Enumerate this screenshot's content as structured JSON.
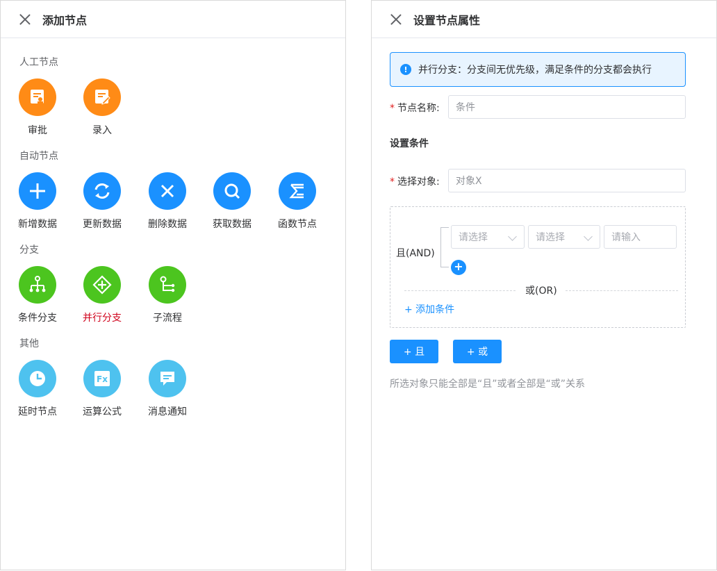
{
  "left": {
    "title": "添加节点",
    "groups": [
      {
        "title": "人工节点",
        "nodes": [
          {
            "label": "审批",
            "icon": "approval-icon",
            "color": "#ff8b16"
          },
          {
            "label": "录入",
            "icon": "entry-icon",
            "color": "#ff8b16"
          }
        ]
      },
      {
        "title": "自动节点",
        "nodes": [
          {
            "label": "新增数据",
            "icon": "plus-icon",
            "color": "#1a91ff"
          },
          {
            "label": "更新数据",
            "icon": "refresh-icon",
            "color": "#1a91ff"
          },
          {
            "label": "删除数据",
            "icon": "close-icon",
            "color": "#1a91ff"
          },
          {
            "label": "获取数据",
            "icon": "search-icon",
            "color": "#1a91ff"
          },
          {
            "label": "函数节点",
            "icon": "sigma-icon",
            "color": "#1a91ff"
          }
        ]
      },
      {
        "title": "分支",
        "nodes": [
          {
            "label": "条件分支",
            "icon": "condition-branch-icon",
            "color": "#4cc51f"
          },
          {
            "label": "并行分支",
            "icon": "parallel-branch-icon",
            "color": "#4cc51f",
            "selected": true
          },
          {
            "label": "子流程",
            "icon": "subflow-icon",
            "color": "#4cc51f"
          }
        ]
      },
      {
        "title": "其他",
        "nodes": [
          {
            "label": "延时节点",
            "icon": "clock-icon",
            "color": "#4ec2ef"
          },
          {
            "label": "运算公式",
            "icon": "formula-icon",
            "color": "#4ec2ef"
          },
          {
            "label": "消息通知",
            "icon": "message-icon",
            "color": "#4ec2ef"
          }
        ]
      }
    ]
  },
  "right": {
    "title": "设置节点属性",
    "alert": "并行分支：分支间无优先级，满足条件的分支都会执行",
    "name_label": "节点名称:",
    "name_value": "条件",
    "section_title": "设置条件",
    "object_label": "选择对象:",
    "object_value": "对象X",
    "and_label": "且(AND)",
    "select1_placeholder": "请选择",
    "select2_placeholder": "请选择",
    "input_placeholder": "请输入",
    "or_label": "或(OR)",
    "add_condition": "+ 添加条件",
    "and_button": "+ 且",
    "or_button": "+ 或",
    "hint": "所选对象只能全部是“且”或者全部是“或”关系"
  },
  "colors": {
    "primary": "#1a91ff",
    "selected": "#d0021b",
    "required": "#e02020"
  }
}
